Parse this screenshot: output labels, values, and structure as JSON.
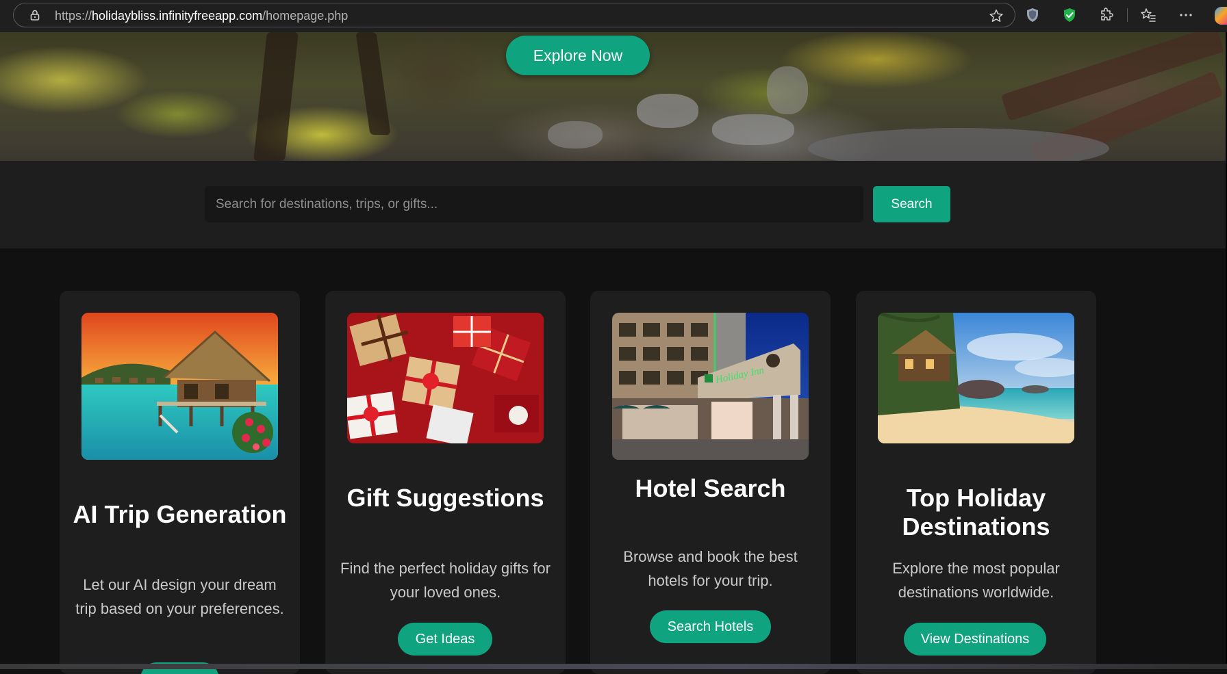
{
  "browser": {
    "url_scheme": "https://",
    "url_domain": "holidaybliss.infinityfreeapp.com",
    "url_path": "/homepage.php",
    "icons": [
      "lock-icon",
      "star-icon",
      "shield-extension-icon",
      "check-shield-extension-icon",
      "puzzle-extensions-icon",
      "favorites-icon",
      "more-menu-icon"
    ]
  },
  "hero": {
    "cta_label": "Explore Now"
  },
  "search": {
    "placeholder": "Search for destinations, trips, or gifts...",
    "button_label": "Search"
  },
  "cards": [
    {
      "title": "AI Trip Generation",
      "description": "Let our AI design your dream trip based on your preferences.",
      "button_label": "",
      "image": "overwater-bungalow-photo"
    },
    {
      "title": "Gift Suggestions",
      "description": "Find the perfect holiday gifts for your loved ones.",
      "button_label": "Get Ideas",
      "image": "wrapped-gifts-photo"
    },
    {
      "title": "Hotel Search",
      "description": "Browse and book the best hotels for your trip.",
      "button_label": "Search Hotels",
      "image": "holiday-inn-hotel-photo",
      "image_sign_text": "Holiday Inn"
    },
    {
      "title": "Top Holiday Destinations",
      "description": "Explore the most popular destinations worldwide.",
      "button_label": "View Destinations",
      "image": "tropical-beach-photo"
    }
  ],
  "colors": {
    "accent": "#10a37f",
    "page_background": "#111111",
    "card_background": "#1e1e1e",
    "band_background": "#1e1e1e"
  }
}
